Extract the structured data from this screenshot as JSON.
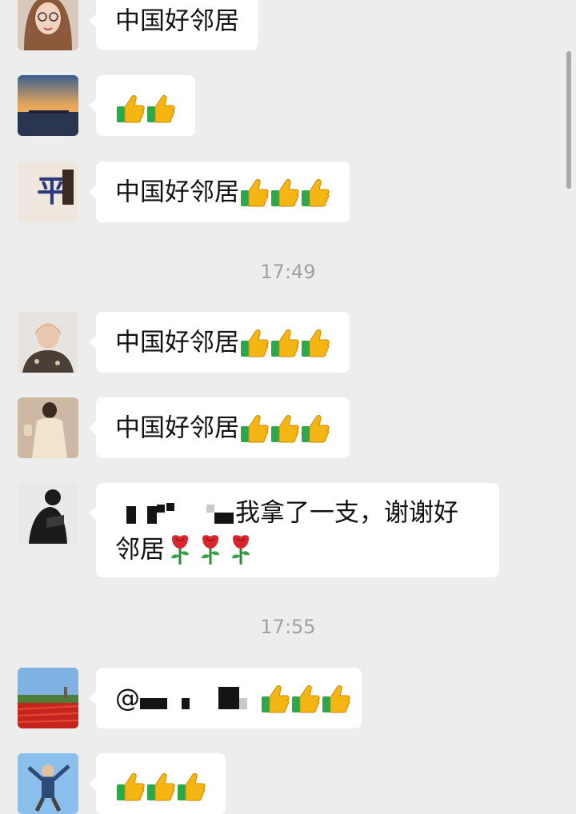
{
  "messages": [
    {
      "text": "中国好邻居",
      "emoji": "",
      "emoji_count": 0
    },
    {
      "text": "",
      "emoji": "thumbs-up",
      "emoji_count": 2
    },
    {
      "text": "中国好邻居",
      "emoji": "thumbs-up",
      "emoji_count": 3
    },
    {
      "text": "中国好邻居",
      "emoji": "thumbs-up",
      "emoji_count": 3
    },
    {
      "text": "中国好邻居",
      "emoji": "thumbs-up",
      "emoji_count": 3
    },
    {
      "text_line1": "我拿了一支，谢谢好",
      "text_line2": "邻居",
      "emoji": "rose",
      "emoji_count": 3,
      "redacted": true
    },
    {
      "at_symbol": "@",
      "emoji": "thumbs-up",
      "emoji_count": 3,
      "redacted": true
    },
    {
      "text": "",
      "emoji": "thumbs-up",
      "emoji_count": 3
    }
  ],
  "timestamps": [
    "17:49",
    "17:55"
  ],
  "colors": {
    "background": "#ededed",
    "bubble": "#ffffff",
    "timestamp": "#a0a0a0",
    "thumb": "#f5b512",
    "cuff": "#2aa84a"
  }
}
